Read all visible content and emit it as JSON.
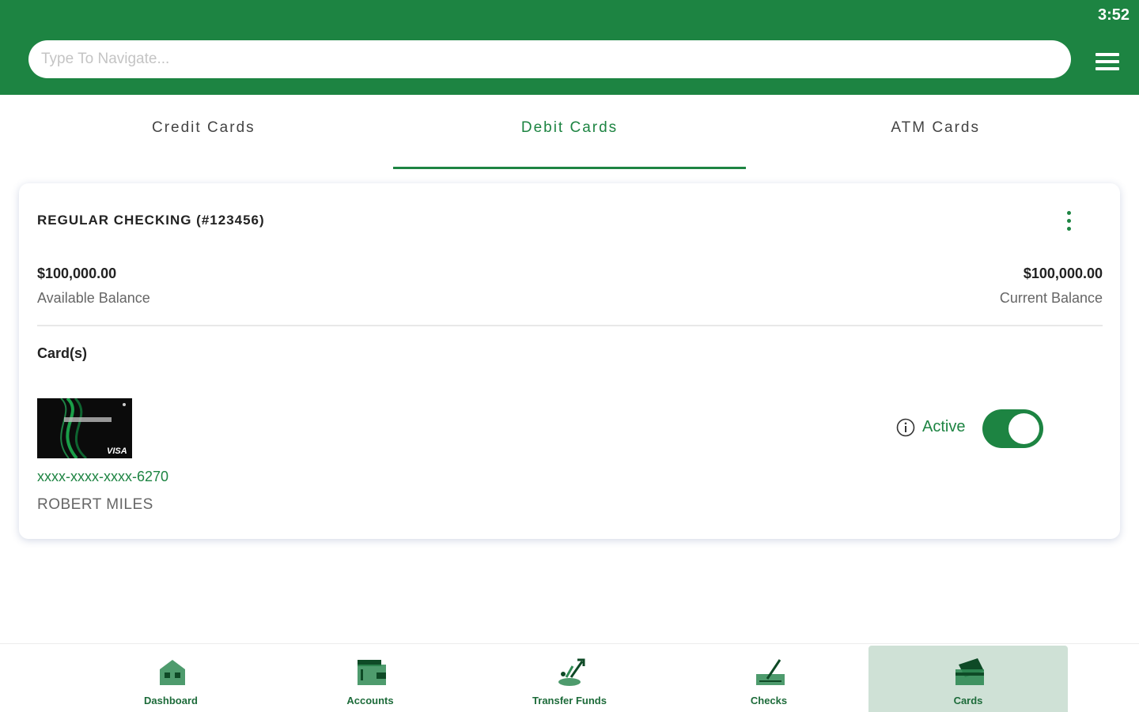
{
  "status_bar": {
    "time": "3:52"
  },
  "header": {
    "search_placeholder": "Type To Navigate...",
    "menu_icon": "hamburger-menu-icon"
  },
  "tabs": [
    {
      "label": "Credit Cards",
      "active": false
    },
    {
      "label": "Debit Cards",
      "active": true
    },
    {
      "label": "ATM Cards",
      "active": false
    }
  ],
  "account": {
    "title": "REGULAR CHECKING (#123456)",
    "available_amount": "$100,000.00",
    "available_label": "Available Balance",
    "current_amount": "$100,000.00",
    "current_label": "Current Balance",
    "cards_label": "Card(s)",
    "card": {
      "masked_number": "xxxx-xxxx-xxxx-6270",
      "owner": "ROBERT MILES",
      "status": "Active",
      "enabled": true,
      "image_brand": "VISA"
    }
  },
  "bottom_nav": [
    {
      "label": "Dashboard",
      "icon": "dashboard-house-icon",
      "active": false
    },
    {
      "label": "Accounts",
      "icon": "accounts-wallet-icon",
      "active": false
    },
    {
      "label": "Transfer Funds",
      "icon": "transfer-funds-icon",
      "active": false
    },
    {
      "label": "Checks",
      "icon": "checks-pen-icon",
      "active": false
    },
    {
      "label": "Cards",
      "icon": "cards-icon",
      "active": true
    }
  ],
  "colors": {
    "primary": "#1d8442",
    "nav_active_bg": "#cfe1d6"
  }
}
